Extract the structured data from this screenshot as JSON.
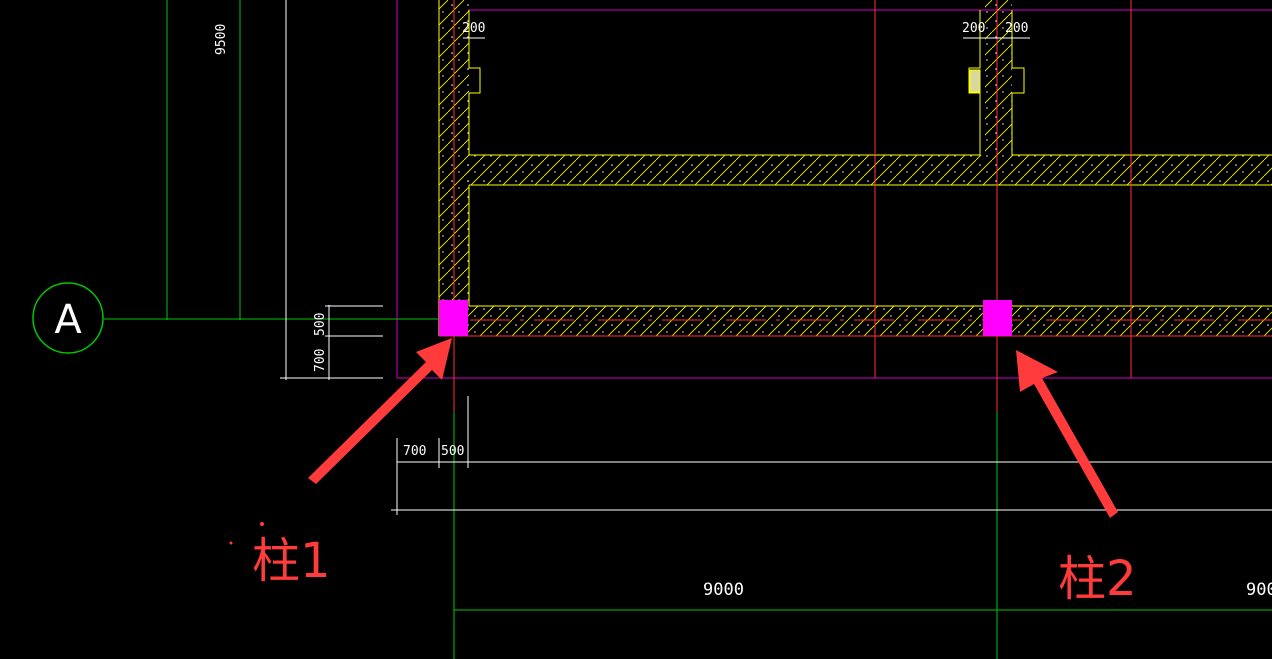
{
  "axis": {
    "label": "A"
  },
  "dimensions": {
    "top_left_vertical": "9500",
    "top_200_a": "200",
    "top_200_b": "200",
    "top_200_c": "200",
    "left_500": "500",
    "left_700": "700",
    "bottom_700": "700",
    "bottom_500": "500",
    "span_9000": "9000",
    "span_right_partial": "900"
  },
  "callouts": {
    "column1": "柱1",
    "column2": "柱2"
  },
  "colors": {
    "background": "#000000",
    "grid_line": "#00c800",
    "wall_outline": "#ffff00",
    "axis_red": "#ff3030",
    "boundary_magenta": "#d000d0",
    "column_fill": "#ff00ff",
    "arrow": "#ff3b3b",
    "dim_line": "#ffffff"
  }
}
